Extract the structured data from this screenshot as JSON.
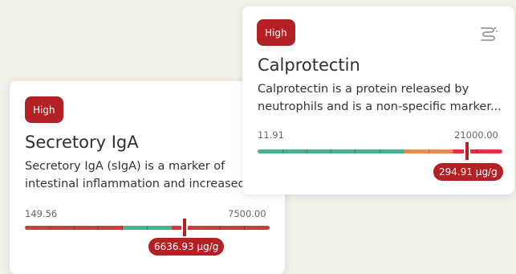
{
  "cards": {
    "secretory_iga": {
      "badge": "High",
      "title": "Secretory IgA",
      "description_line1": "Secretory IgA (sIgA) is a marker of",
      "description_line2": "intestinal inflammation and increased i",
      "range_min": "149.56",
      "range_max": "7500.00",
      "value_label": "6636.93 µg/g",
      "value_fraction": 0.66
    },
    "calprotectin": {
      "badge": "High",
      "title": "Calprotectin",
      "description_line1": "Calprotectin is a protein released by",
      "description_line2": "neutrophils and is a non-specific marker...",
      "range_min": "11.91",
      "range_max": "21000.00",
      "value_label": "294.91 µg/g",
      "value_fraction": 0.86,
      "icon": "intestine-icon"
    }
  },
  "colors": {
    "high": "#b42124",
    "red_zone": "#d9363e",
    "green_zone": "#48b28a",
    "orange_zone": "#ee8b4a"
  }
}
